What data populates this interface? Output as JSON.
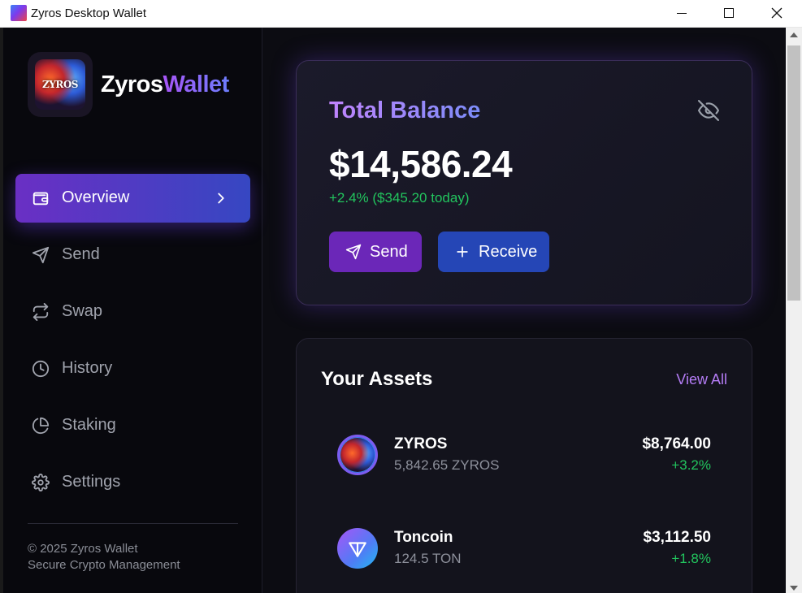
{
  "window": {
    "title": "Zyros Desktop Wallet"
  },
  "sidebar": {
    "brand": {
      "part1": "Zyros",
      "part2": "Wallet",
      "emblem_text": "ZYROS"
    },
    "items": [
      {
        "label": "Overview",
        "icon": "wallet-icon",
        "active": true
      },
      {
        "label": "Send",
        "icon": "send-icon",
        "active": false
      },
      {
        "label": "Swap",
        "icon": "swap-icon",
        "active": false
      },
      {
        "label": "History",
        "icon": "clock-icon",
        "active": false
      },
      {
        "label": "Staking",
        "icon": "pie-chart-icon",
        "active": false
      },
      {
        "label": "Settings",
        "icon": "gear-icon",
        "active": false
      }
    ],
    "footer": {
      "copyright": "© 2025 Zyros Wallet",
      "tagline": "Secure Crypto Management"
    }
  },
  "balance": {
    "title": "Total Balance",
    "amount": "$14,586.24",
    "change": "+2.4% ($345.20 today)",
    "send_label": "Send",
    "receive_label": "Receive"
  },
  "assets": {
    "title": "Your Assets",
    "view_all": "View All",
    "items": [
      {
        "name": "ZYROS",
        "amount": "5,842.65 ZYROS",
        "value": "$8,764.00",
        "change": "+3.2%"
      },
      {
        "name": "Toncoin",
        "amount": "124.5 TON",
        "value": "$3,112.50",
        "change": "+1.8%"
      }
    ]
  },
  "colors": {
    "accent_purple": "#6b27b8",
    "accent_blue": "#2546b6",
    "positive_green": "#22c55e",
    "background": "#0c0c12"
  }
}
